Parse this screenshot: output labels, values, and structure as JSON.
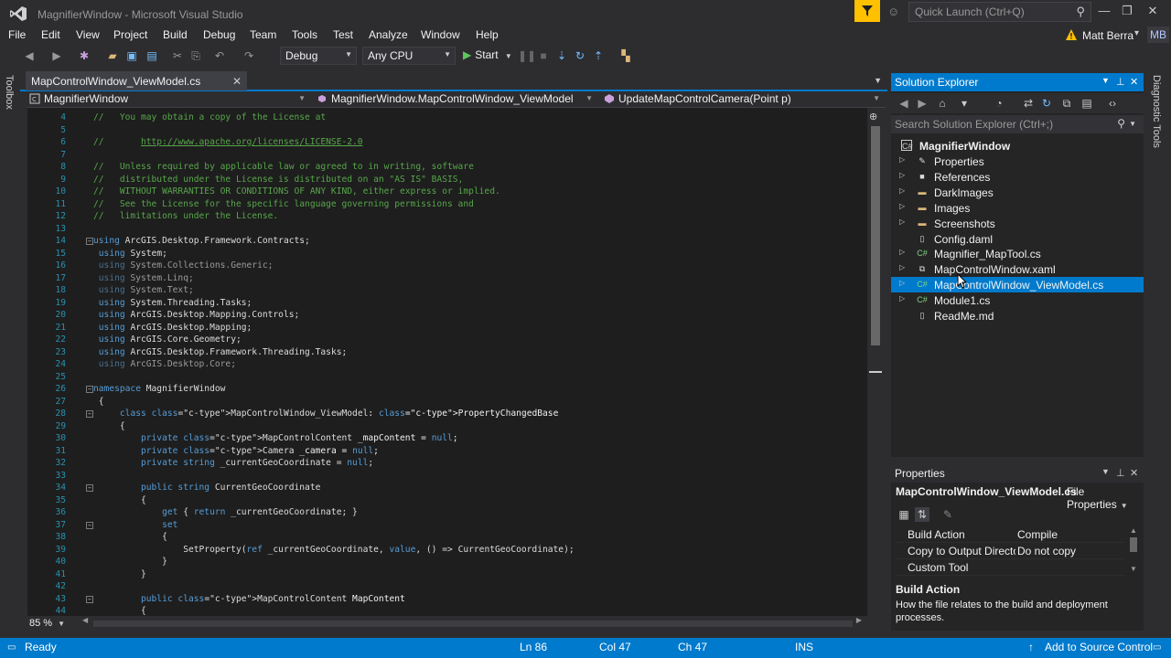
{
  "window": {
    "title": "MagnifierWindow - Microsoft Visual Studio",
    "quick_launch_placeholder": "Quick Launch (Ctrl+Q)",
    "minimize": "—",
    "maximize": "❐",
    "close": "✕"
  },
  "menu": [
    "File",
    "Edit",
    "View",
    "Project",
    "Build",
    "Debug",
    "Team",
    "Tools",
    "Test",
    "Analyze",
    "Window",
    "Help"
  ],
  "user": {
    "name": "Matt Berra",
    "initials": "MB"
  },
  "toolbar": {
    "config": "Debug",
    "platform": "Any CPU",
    "start_label": "Start"
  },
  "side_tabs": {
    "left": "Toolbox",
    "right": "Diagnostic Tools"
  },
  "editor": {
    "tab_label": "MapControlWindow_ViewModel.cs",
    "nav_project": "MagnifierWindow",
    "nav_class": "MagnifierWindow.MapControlWindow_ViewModel",
    "nav_member": "UpdateMapControlCamera(Point p)",
    "zoom": "85 %",
    "lines": [
      {
        "n": "4",
        "t": "//   You may obtain a copy of the License at"
      },
      {
        "n": "5",
        "t": ""
      },
      {
        "n": "6",
        "t": "//       http://www.apache.org/licenses/LICENSE-2.0"
      },
      {
        "n": "7",
        "t": ""
      },
      {
        "n": "8",
        "t": "//   Unless required by applicable law or agreed to in writing, software"
      },
      {
        "n": "9",
        "t": "//   distributed under the License is distributed on an \"AS IS\" BASIS,"
      },
      {
        "n": "10",
        "t": "//   WITHOUT WARRANTIES OR CONDITIONS OF ANY KIND, either express or implied."
      },
      {
        "n": "11",
        "t": "//   See the License for the specific language governing permissions and"
      },
      {
        "n": "12",
        "t": "//   limitations under the License."
      },
      {
        "n": "13",
        "t": ""
      },
      {
        "n": "14",
        "t": "using ArcGIS.Desktop.Framework.Contracts;"
      },
      {
        "n": "15",
        "t": " using System;"
      },
      {
        "n": "16",
        "t": " using System.Collections.Generic;"
      },
      {
        "n": "17",
        "t": " using System.Linq;"
      },
      {
        "n": "18",
        "t": " using System.Text;"
      },
      {
        "n": "19",
        "t": " using System.Threading.Tasks;"
      },
      {
        "n": "20",
        "t": " using ArcGIS.Desktop.Mapping.Controls;"
      },
      {
        "n": "21",
        "t": " using ArcGIS.Desktop.Mapping;"
      },
      {
        "n": "22",
        "t": " using ArcGIS.Core.Geometry;"
      },
      {
        "n": "23",
        "t": " using ArcGIS.Desktop.Framework.Threading.Tasks;"
      },
      {
        "n": "24",
        "t": " using ArcGIS.Desktop.Core;"
      },
      {
        "n": "25",
        "t": ""
      },
      {
        "n": "26",
        "t": "namespace MagnifierWindow"
      },
      {
        "n": "27",
        "t": " {"
      },
      {
        "n": "28",
        "t": "     class MapControlWindow_ViewModel: PropertyChangedBase"
      },
      {
        "n": "29",
        "t": "     {"
      },
      {
        "n": "30",
        "t": "         private MapControlContent _mapContent = null;"
      },
      {
        "n": "31",
        "t": "         private Camera _camera = null;"
      },
      {
        "n": "32",
        "t": "         private string _currentGeoCoordinate = null;"
      },
      {
        "n": "33",
        "t": ""
      },
      {
        "n": "34",
        "t": "         public string CurrentGeoCoordinate"
      },
      {
        "n": "35",
        "t": "         {"
      },
      {
        "n": "36",
        "t": "             get { return _currentGeoCoordinate; }"
      },
      {
        "n": "37",
        "t": "             set"
      },
      {
        "n": "38",
        "t": "             {"
      },
      {
        "n": "39",
        "t": "                 SetProperty(ref _currentGeoCoordinate, value, () => CurrentGeoCoordinate);"
      },
      {
        "n": "40",
        "t": "             }"
      },
      {
        "n": "41",
        "t": "         }"
      },
      {
        "n": "42",
        "t": ""
      },
      {
        "n": "43",
        "t": "         public MapControlContent MapContent"
      },
      {
        "n": "44",
        "t": "         {"
      }
    ]
  },
  "solution_explorer": {
    "title": "Solution Explorer",
    "search_placeholder": "Search Solution Explorer (Ctrl+;)",
    "root": "MagnifierWindow",
    "items": [
      {
        "label": "Properties",
        "icon": "wrench-icon",
        "expandable": true
      },
      {
        "label": "References",
        "icon": "references-icon",
        "expandable": true
      },
      {
        "label": "DarkImages",
        "icon": "folder-icon",
        "expandable": true
      },
      {
        "label": "Images",
        "icon": "folder-icon",
        "expandable": true
      },
      {
        "label": "Screenshots",
        "icon": "folder-icon",
        "expandable": true
      },
      {
        "label": "Config.daml",
        "icon": "file-icon",
        "expandable": false
      },
      {
        "label": "Magnifier_MapTool.cs",
        "icon": "csharp-file-icon",
        "expandable": true
      },
      {
        "label": "MapControlWindow.xaml",
        "icon": "xaml-file-icon",
        "expandable": true
      },
      {
        "label": "MapControlWindow_ViewModel.cs",
        "icon": "csharp-file-icon",
        "expandable": true,
        "selected": true
      },
      {
        "label": "Module1.cs",
        "icon": "csharp-file-icon",
        "expandable": true
      },
      {
        "label": "ReadMe.md",
        "icon": "file-icon",
        "expandable": false
      }
    ]
  },
  "properties": {
    "title": "Properties",
    "object": "MapControlWindow_ViewModel.cs",
    "object_type": "File Properties",
    "rows": [
      {
        "name": "Build Action",
        "value": "Compile"
      },
      {
        "name": "Copy to Output Directo",
        "value": "Do not copy"
      },
      {
        "name": "Custom Tool",
        "value": ""
      }
    ],
    "desc_title": "Build Action",
    "desc_text": "How the file relates to the build and deployment processes."
  },
  "status": {
    "state": "Ready",
    "ln": "Ln 86",
    "col": "Col 47",
    "ch": "Ch 47",
    "mode": "INS",
    "source_control": "Add to Source Control"
  },
  "colors": {
    "accent": "#007acc",
    "notification": "#ffc000",
    "editor_bg": "#1e1e1e",
    "chrome_bg": "#2d2d30"
  }
}
